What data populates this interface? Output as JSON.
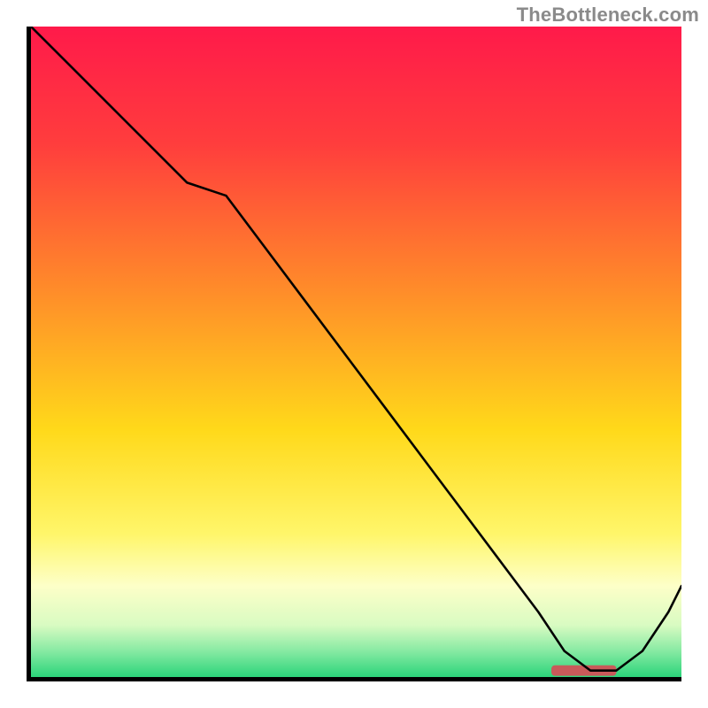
{
  "watermark": "TheBottleneck.com",
  "chart_data": {
    "type": "line",
    "title": "",
    "xlabel": "",
    "ylabel": "",
    "xlim": [
      0,
      100
    ],
    "ylim": [
      0,
      100
    ],
    "grid": false,
    "legend": false,
    "gradient_stops": [
      {
        "offset": 0.0,
        "color": "#ff1a4a"
      },
      {
        "offset": 0.18,
        "color": "#ff3d3d"
      },
      {
        "offset": 0.4,
        "color": "#ff8a2a"
      },
      {
        "offset": 0.62,
        "color": "#ffd91a"
      },
      {
        "offset": 0.78,
        "color": "#fff66a"
      },
      {
        "offset": 0.86,
        "color": "#fdffc8"
      },
      {
        "offset": 0.92,
        "color": "#d9fbc2"
      },
      {
        "offset": 0.96,
        "color": "#87eaa3"
      },
      {
        "offset": 1.0,
        "color": "#2bd47a"
      }
    ],
    "series": [
      {
        "name": "bottleneck-curve",
        "x": [
          0,
          6,
          12,
          18,
          24,
          30,
          36,
          42,
          48,
          54,
          60,
          66,
          72,
          78,
          82,
          86,
          90,
          94,
          98,
          100
        ],
        "y": [
          100,
          94,
          88,
          82,
          76,
          74,
          66,
          58,
          50,
          42,
          34,
          26,
          18,
          10,
          4,
          1,
          1,
          4,
          10,
          14
        ]
      }
    ],
    "marker": {
      "name": "optimal-range-marker",
      "x_start": 80,
      "x_end": 90,
      "y": 1.0,
      "color": "#c95a5a"
    }
  }
}
